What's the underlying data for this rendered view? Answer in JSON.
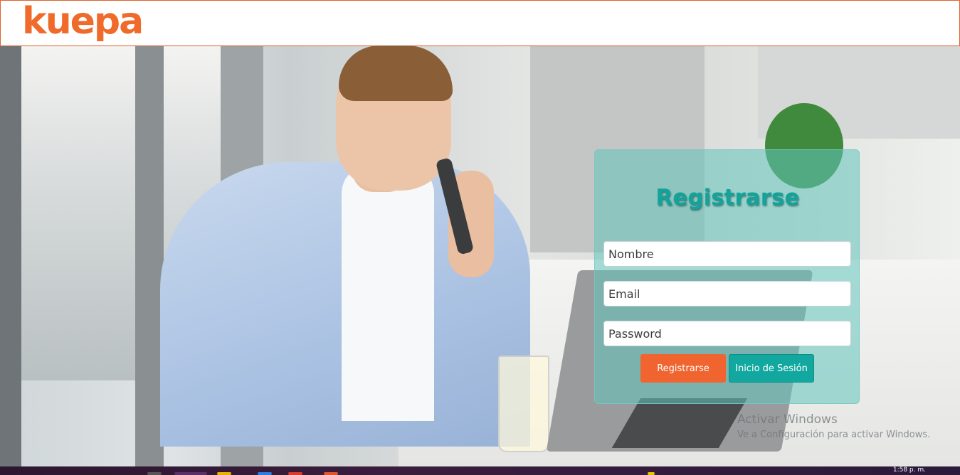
{
  "header": {
    "logo_text": "kuepa"
  },
  "register_form": {
    "title": "Registrarse",
    "name_placeholder": "Nombre",
    "email_placeholder": "Email",
    "password_placeholder": "Password",
    "register_button": "Registrarse",
    "login_button": "Inicio de Sesión"
  },
  "watermark": {
    "title": "Activar Windows",
    "subtitle": "Ve a Configuración para activar Windows."
  },
  "taskbar": {
    "clock": "1:58 p. m."
  },
  "colors": {
    "brand_orange": "#ef6a2b",
    "accent_teal": "#12a8a0",
    "register_button": "#f0652f"
  }
}
